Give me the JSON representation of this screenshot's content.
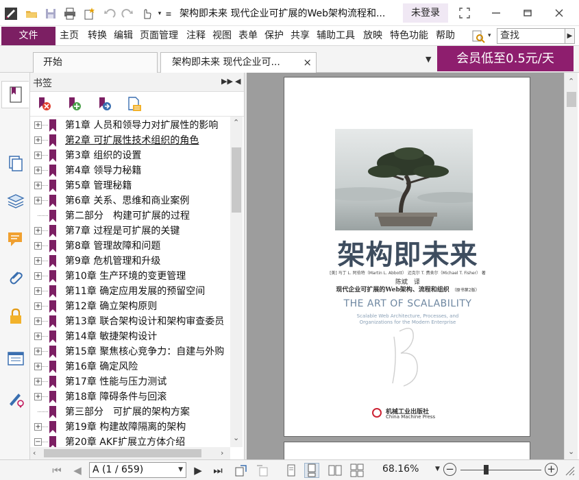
{
  "titlebar": {
    "doc_title": "架构即未来 现代企业可扩展的Web架构流程和...",
    "login_label": "未登录",
    "icons": [
      "app-logo-icon",
      "open-folder-icon",
      "save-icon",
      "print-icon",
      "new-icon",
      "undo-icon",
      "redo-icon",
      "hand-tool-icon",
      "customize-icon"
    ]
  },
  "menubar": {
    "file_label": "文件",
    "items": [
      "主页",
      "转换",
      "编辑",
      "页面管理",
      "注释",
      "视图",
      "表单",
      "保护",
      "共享",
      "辅助工具",
      "放映",
      "特色功能",
      "帮助"
    ],
    "search_placeholder": "查找"
  },
  "tabs": {
    "start_label": "开始",
    "doc_label": "架构即未来 现代企业可...",
    "close_glyph": "×",
    "vip_label": "会员低至0.5元/天"
  },
  "bookmarks": {
    "title": "书签",
    "items": [
      {
        "label": "第1章 人员和领导力对扩展性的影响",
        "expandable": true
      },
      {
        "label": "第2章 可扩展性技术组织的角色",
        "expandable": true,
        "active": true
      },
      {
        "label": "第3章 组织的设置",
        "expandable": true
      },
      {
        "label": "第4章 领导力秘籍",
        "expandable": true
      },
      {
        "label": "第5章 管理秘籍",
        "expandable": true
      },
      {
        "label": "第6章 关系、思维和商业案例",
        "expandable": true
      },
      {
        "label": "第二部分　构建可扩展的过程",
        "expandable": false
      },
      {
        "label": "第7章 过程是可扩展的关键",
        "expandable": true
      },
      {
        "label": "第8章 管理故障和问题",
        "expandable": true
      },
      {
        "label": "第9章 危机管理和升级",
        "expandable": true
      },
      {
        "label": "第10章 生产环境的变更管理",
        "expandable": true
      },
      {
        "label": "第11章 确定应用发展的预留空间",
        "expandable": true
      },
      {
        "label": "第12章 确立架构原则",
        "expandable": true
      },
      {
        "label": "第13章 联合架构设计和架构审查委员",
        "expandable": true
      },
      {
        "label": "第14章 敏捷架构设计",
        "expandable": true
      },
      {
        "label": "第15章 聚焦核心竞争力：自建与外购",
        "expandable": true
      },
      {
        "label": "第16章 确定风险",
        "expandable": true
      },
      {
        "label": "第17章 性能与压力测试",
        "expandable": true
      },
      {
        "label": "第18章 障碍条件与回滚",
        "expandable": true
      },
      {
        "label": "第三部分　可扩展的架构方案",
        "expandable": false
      },
      {
        "label": "第19章 构建故障隔离的架构",
        "expandable": true
      },
      {
        "label": "第20章 AKF扩展立方体介绍",
        "expandable": true
      }
    ]
  },
  "cover": {
    "title": "架构即未来",
    "authors": "[美] 马丁 L. 阿伯特（Martin L. Abbott） 迈克尔 T. 费舍尔（Michael T. Fisher） 著",
    "translator": "陈斌　译",
    "subtitle": "现代企业可扩展的Web架构、流程和组织",
    "edition": "（原书第2版）",
    "en_title": "THE ART OF SCALABILITY",
    "en_sub1": "Scalable Web Architecture, Processes, and",
    "en_sub2": "Organizations for the Modern Enterprise",
    "publisher_cn": "机械工业出版社",
    "publisher_en": "China Machine Press"
  },
  "statusbar": {
    "page_value": "A (1 / 659)",
    "zoom_label": "68.16%",
    "zoom_fraction": 0.32
  },
  "colors": {
    "brand": "#7c1f63",
    "vip_banner": "#8e1e6e",
    "login_bg": "#f0e8f4",
    "viewer_bg": "#9d9d9d"
  }
}
